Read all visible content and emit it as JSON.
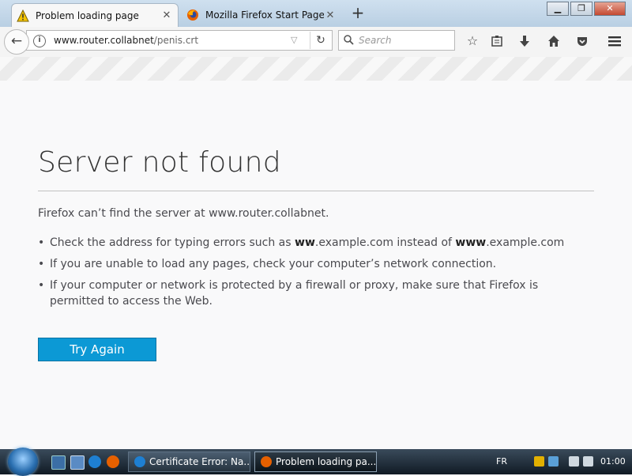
{
  "browser": {
    "tabs": [
      {
        "label": "Problem loading page",
        "icon": "warning-icon"
      },
      {
        "label": "Mozilla Firefox Start Page",
        "icon": "firefox-icon"
      }
    ],
    "new_tab_label": "+",
    "url": {
      "domain": "www.router.collabnet",
      "path": "/penis.crt"
    },
    "search_placeholder": "Search"
  },
  "page": {
    "title": "Server not found",
    "description": "Firefox can’t find the server at www.router.collabnet.",
    "bullets": [
      {
        "pre": "Check the address for typing errors such as ",
        "b1": "ww",
        "mid": ".example.com instead of ",
        "b2": "www",
        "post": ".example.com"
      },
      {
        "text": "If you are unable to load any pages, check your computer’s network connection."
      },
      {
        "text": "If your computer or network is protected by a firewall or proxy, make sure that Firefox is permitted to access the Web."
      }
    ],
    "try_again": "Try Again"
  },
  "taskbar": {
    "tasks": [
      {
        "label": "Certificate Error: Na...",
        "icon": "ie-icon"
      },
      {
        "label": "Problem loading pa...",
        "icon": "firefox-icon"
      }
    ],
    "language": "FR",
    "clock": "01:00"
  },
  "colors": {
    "accent": "#0c99d5",
    "firefox": "#e66000",
    "ie": "#1e7fd2",
    "taskbar": "#1b2733"
  }
}
